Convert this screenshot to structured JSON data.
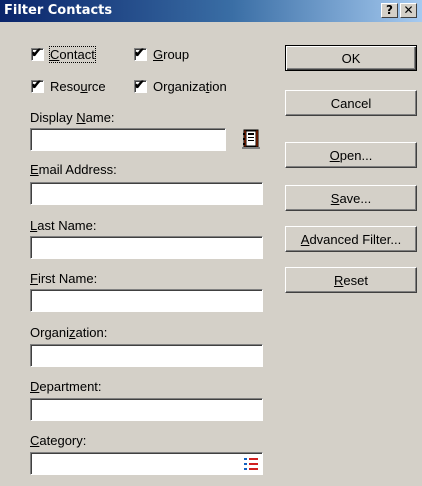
{
  "window": {
    "title": "Filter Contacts",
    "help_glyph": "?",
    "close_glyph": "✕"
  },
  "checkboxes": {
    "contact": {
      "pre": "",
      "key": "C",
      "post": "ontact",
      "checked": true
    },
    "group": {
      "pre": "",
      "key": "G",
      "post": "roup",
      "checked": true
    },
    "resource": {
      "pre": "Reso",
      "key": "u",
      "post": "rce",
      "checked": true
    },
    "organization": {
      "pre": "Organiza",
      "key": "t",
      "post": "ion",
      "checked": true
    },
    "check_glyph": "✔"
  },
  "fields": {
    "display_name": {
      "pre": "Display ",
      "key": "N",
      "post": "ame:",
      "value": ""
    },
    "email_address": {
      "pre": "",
      "key": "E",
      "post": "mail Address:",
      "value": ""
    },
    "last_name": {
      "pre": "",
      "key": "L",
      "post": "ast Name:",
      "value": ""
    },
    "first_name": {
      "pre": "",
      "key": "F",
      "post": "irst Name:",
      "value": ""
    },
    "organization": {
      "pre": "Organi",
      "key": "z",
      "post": "ation:",
      "value": ""
    },
    "department": {
      "pre": "",
      "key": "D",
      "post": "epartment:",
      "value": ""
    },
    "category": {
      "pre": "",
      "key": "C",
      "post": "ategory:",
      "value": ""
    }
  },
  "buttons": {
    "ok": {
      "pre": "OK",
      "key": "",
      "post": ""
    },
    "cancel": {
      "pre": "Cancel",
      "key": "",
      "post": ""
    },
    "open": {
      "pre": "",
      "key": "O",
      "post": "pen..."
    },
    "save": {
      "pre": "",
      "key": "S",
      "post": "ave..."
    },
    "advanced_filter": {
      "pre": "",
      "key": "A",
      "post": "dvanced Filter..."
    },
    "reset": {
      "pre": "",
      "key": "R",
      "post": "eset"
    }
  },
  "icons": {
    "address_book": "address-book-icon",
    "category_list": "category-list-icon"
  }
}
